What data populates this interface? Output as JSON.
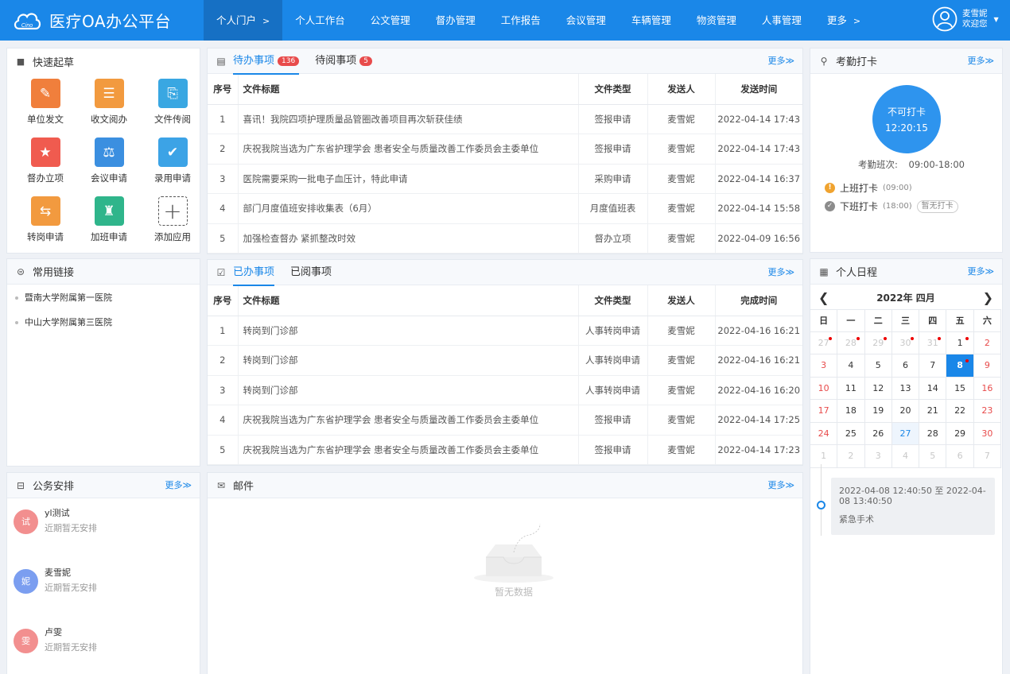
{
  "header": {
    "title": "医疗OA办公平台",
    "logo_text": "Cino",
    "nav": [
      {
        "label": "个人门户",
        "suffix": ">",
        "active": true
      },
      {
        "label": "个人工作台"
      },
      {
        "label": "公文管理"
      },
      {
        "label": "督办管理"
      },
      {
        "label": "工作报告"
      },
      {
        "label": "会议管理"
      },
      {
        "label": "车辆管理"
      },
      {
        "label": "物资管理"
      },
      {
        "label": "人事管理"
      },
      {
        "label": "更多",
        "suffix": ">"
      }
    ],
    "user": {
      "name": "麦雪妮",
      "greeting": "欢迎您"
    }
  },
  "quick": {
    "title": "快速起草",
    "items": [
      {
        "label": "单位发文",
        "icon": "document-edit-icon",
        "color": "#f07f3c"
      },
      {
        "label": "收文阅办",
        "icon": "document-list-icon",
        "color": "#f29a3f"
      },
      {
        "label": "文件传阅",
        "icon": "file-share-icon",
        "color": "#39a7e2"
      },
      {
        "label": "督办立项",
        "icon": "badge-star-icon",
        "color": "#f05b4f"
      },
      {
        "label": "会议申请",
        "icon": "meeting-icon",
        "color": "#3b8fe0"
      },
      {
        "label": "录用申请",
        "icon": "checkbox-icon",
        "color": "#3ca3e6"
      },
      {
        "label": "转岗申请",
        "icon": "transfer-icon",
        "color": "#f29a3f"
      },
      {
        "label": "加班申请",
        "icon": "lamp-icon",
        "color": "#2fb58b"
      },
      {
        "label": "添加应用",
        "icon": "plus-icon",
        "color": "#ffffff"
      }
    ]
  },
  "links": {
    "title": "常用链接",
    "items": [
      "暨南大学附属第一医院",
      "中山大学附属第三医院"
    ]
  },
  "schedule": {
    "title": "公务安排",
    "more": "更多≫",
    "items": [
      {
        "avatar": "试",
        "name": "yl测试",
        "desc": "近期暂无安排",
        "color": "#f28f8f"
      },
      {
        "avatar": "妮",
        "name": "麦雪妮",
        "desc": "近期暂无安排",
        "color": "#7b9ef0"
      },
      {
        "avatar": "雯",
        "name": "卢雯",
        "desc": "近期暂无安排",
        "color": "#f28f8f"
      }
    ]
  },
  "todo": {
    "tabs": [
      {
        "label": "待办事项",
        "badge": "136"
      },
      {
        "label": "待阅事项",
        "badge": "5"
      }
    ],
    "more": "更多≫",
    "columns": [
      "序号",
      "文件标题",
      "文件类型",
      "发送人",
      "发送时间"
    ],
    "rows": [
      [
        "1",
        "喜讯！我院四项护理质量品管圈改善项目再次斩获佳绩",
        "签报申请",
        "麦雪妮",
        "2022-04-14 17:43"
      ],
      [
        "2",
        "庆祝我院当选为广东省护理学会 患者安全与质量改善工作委员会主委单位",
        "签报申请",
        "麦雪妮",
        "2022-04-14 17:43"
      ],
      [
        "3",
        "医院需要采购一批电子血压计，特此申请",
        "采购申请",
        "麦雪妮",
        "2022-04-14 16:37"
      ],
      [
        "4",
        "部门月度值班安排收集表（6月）",
        "月度值班表",
        "麦雪妮",
        "2022-04-14 15:58"
      ],
      [
        "5",
        "加强检查督办 紧抓整改时效",
        "督办立项",
        "麦雪妮",
        "2022-04-09 16:56"
      ]
    ]
  },
  "done": {
    "tabs": [
      {
        "label": "已办事项"
      },
      {
        "label": "已阅事项"
      }
    ],
    "more": "更多≫",
    "columns": [
      "序号",
      "文件标题",
      "文件类型",
      "发送人",
      "完成时间"
    ],
    "rows": [
      [
        "1",
        "转岗到门诊部",
        "人事转岗申请",
        "麦雪妮",
        "2022-04-16 16:21"
      ],
      [
        "2",
        "转岗到门诊部",
        "人事转岗申请",
        "麦雪妮",
        "2022-04-16 16:21"
      ],
      [
        "3",
        "转岗到门诊部",
        "人事转岗申请",
        "麦雪妮",
        "2022-04-16 16:20"
      ],
      [
        "4",
        "庆祝我院当选为广东省护理学会 患者安全与质量改善工作委员会主委单位",
        "签报申请",
        "麦雪妮",
        "2022-04-14 17:25"
      ],
      [
        "5",
        "庆祝我院当选为广东省护理学会 患者安全与质量改善工作委员会主委单位",
        "签报申请",
        "麦雪妮",
        "2022-04-14 17:23"
      ]
    ]
  },
  "mail": {
    "title": "邮件",
    "more": "更多≫",
    "empty": "暂无数据"
  },
  "attendance": {
    "title": "考勤打卡",
    "more": "更多≫",
    "status": "不可打卡",
    "time": "12:20:15",
    "shift_label": "考勤班次:",
    "shift": "09:00-18:00",
    "clock_in": {
      "label": "上班打卡",
      "time": "(09:00)"
    },
    "clock_out": {
      "label": "下班打卡",
      "time": "(18:00)",
      "tag": "暂无打卡"
    }
  },
  "calendar": {
    "title": "个人日程",
    "more": "更多≫",
    "month": "2022年 四月",
    "weekdays": [
      "日",
      "一",
      "二",
      "三",
      "四",
      "五",
      "六"
    ],
    "days": [
      {
        "d": "27",
        "other": true,
        "mark": true
      },
      {
        "d": "28",
        "other": true,
        "mark": true
      },
      {
        "d": "29",
        "other": true,
        "mark": true
      },
      {
        "d": "30",
        "other": true,
        "mark": true
      },
      {
        "d": "31",
        "other": true,
        "mark": true
      },
      {
        "d": "1",
        "mark": true
      },
      {
        "d": "2",
        "weekend": true
      },
      {
        "d": "3",
        "weekend": true
      },
      {
        "d": "4"
      },
      {
        "d": "5"
      },
      {
        "d": "6"
      },
      {
        "d": "7"
      },
      {
        "d": "8",
        "today": true,
        "mark": true
      },
      {
        "d": "9",
        "weekend": true
      },
      {
        "d": "10",
        "weekend": true
      },
      {
        "d": "11"
      },
      {
        "d": "12"
      },
      {
        "d": "13"
      },
      {
        "d": "14"
      },
      {
        "d": "15"
      },
      {
        "d": "16",
        "weekend": true
      },
      {
        "d": "17",
        "weekend": true
      },
      {
        "d": "18"
      },
      {
        "d": "19"
      },
      {
        "d": "20"
      },
      {
        "d": "21"
      },
      {
        "d": "22"
      },
      {
        "d": "23",
        "weekend": true
      },
      {
        "d": "24",
        "weekend": true
      },
      {
        "d": "25"
      },
      {
        "d": "26"
      },
      {
        "d": "27",
        "hl": true
      },
      {
        "d": "28"
      },
      {
        "d": "29"
      },
      {
        "d": "30",
        "weekend": true
      },
      {
        "d": "1",
        "other": true
      },
      {
        "d": "2",
        "other": true
      },
      {
        "d": "3",
        "other": true
      },
      {
        "d": "4",
        "other": true
      },
      {
        "d": "5",
        "other": true
      },
      {
        "d": "6",
        "other": true
      },
      {
        "d": "7",
        "other": true
      }
    ],
    "event": {
      "time": "2022-04-08 12:40:50 至 2022-04-08 13:40:50",
      "title": "紧急手术"
    }
  }
}
